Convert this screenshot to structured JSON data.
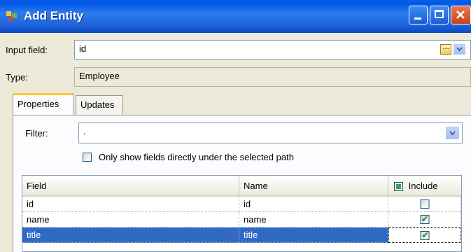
{
  "window": {
    "title": "Add Entity"
  },
  "form": {
    "input_field_label": "Input field:",
    "input_field_value": "id",
    "type_label": "Type:",
    "type_value": "Employee"
  },
  "tabs": [
    {
      "label": "Properties",
      "active": true
    },
    {
      "label": "Updates",
      "active": false
    }
  ],
  "filter": {
    "label": "Filter:",
    "value": "."
  },
  "only_show_option": {
    "label": "Only show fields directly under the selected path",
    "checked": false
  },
  "table": {
    "columns": [
      "Field",
      "Name",
      "Include"
    ],
    "rows": [
      {
        "field": "id",
        "name": "id",
        "include": false,
        "selected": false
      },
      {
        "field": "name",
        "name": "name",
        "include": true,
        "selected": false
      },
      {
        "field": "title",
        "name": "title",
        "include": true,
        "selected": true
      }
    ]
  },
  "colors": {
    "titlebar": "#0A5FE6",
    "selection": "#316AC5",
    "tab_highlight": "#FFC83C",
    "check": "#21A121"
  }
}
